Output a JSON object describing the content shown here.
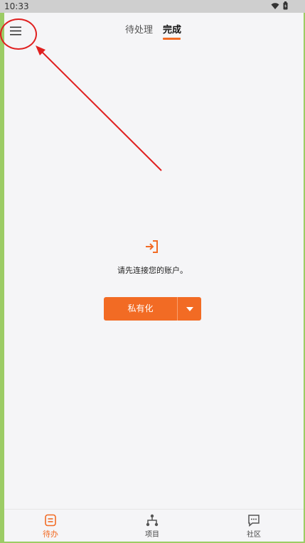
{
  "status_bar": {
    "time": "10:33"
  },
  "header": {
    "tabs": [
      {
        "label": "待处理",
        "active": false
      },
      {
        "label": "完成",
        "active": true
      }
    ]
  },
  "empty_state": {
    "icon": "sign-in-icon",
    "message": "请先连接您的账户。",
    "button_label": "私有化"
  },
  "bottom_nav": {
    "items": [
      {
        "label": "待办",
        "icon": "todo-icon",
        "active": true
      },
      {
        "label": "项目",
        "icon": "project-tree-icon",
        "active": false
      },
      {
        "label": "社区",
        "icon": "chat-bubble-icon",
        "active": false
      }
    ]
  },
  "colors": {
    "accent": "#f26b24",
    "annotation": "#e02020",
    "background": "#f5f5f7"
  }
}
